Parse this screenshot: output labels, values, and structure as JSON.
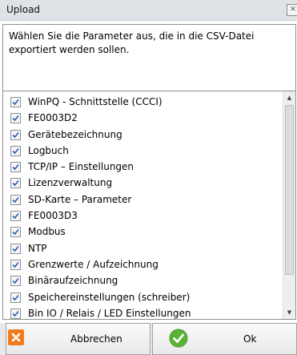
{
  "window": {
    "title": "Upload"
  },
  "description": "Wählen Sie die Parameter aus, die in die CSV-Datei exportiert werden sollen.",
  "parameters": [
    {
      "label": "WinPQ - Schnittstelle (CCCI)",
      "checked": true
    },
    {
      "label": "FE0003D2",
      "checked": true
    },
    {
      "label": "Gerätebezeichnung",
      "checked": true
    },
    {
      "label": "Logbuch",
      "checked": true
    },
    {
      "label": "TCP/IP – Einstellungen",
      "checked": true
    },
    {
      "label": "Lizenzverwaltung",
      "checked": true
    },
    {
      "label": "SD-Karte – Parameter",
      "checked": true
    },
    {
      "label": "FE0003D3",
      "checked": true
    },
    {
      "label": "Modbus",
      "checked": true
    },
    {
      "label": "NTP",
      "checked": true
    },
    {
      "label": "Grenzwerte / Aufzeichnung",
      "checked": true
    },
    {
      "label": "Binäraufzeichnung",
      "checked": true
    },
    {
      "label": "Speichereinstellungen (schreiber)",
      "checked": true
    },
    {
      "label": "Bin IO / Relais / LED Einstellungen",
      "checked": true
    }
  ],
  "buttons": {
    "cancel": "Abbrechen",
    "ok": "Ok"
  },
  "colors": {
    "cancel_icon": "#f07c1f",
    "ok_icon": "#5bb236",
    "checkmark": "#2b5f9e"
  }
}
